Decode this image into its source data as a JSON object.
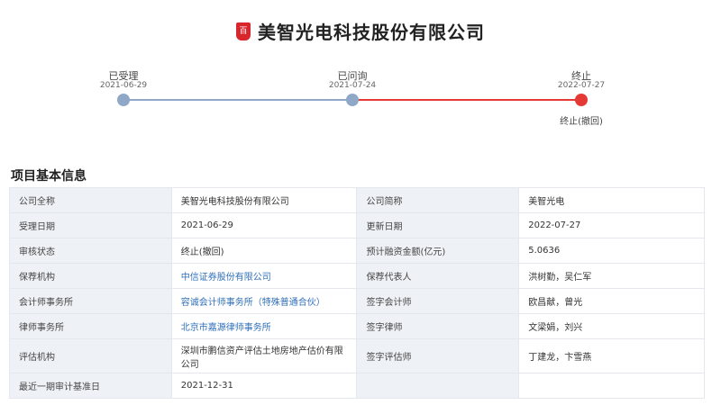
{
  "header": {
    "logo_text": "百",
    "company_name": "美智光电科技股份有限公司"
  },
  "timeline": {
    "steps": [
      {
        "label": "已受理",
        "date": "2021-06-29",
        "status": "done"
      },
      {
        "label": "已问询",
        "date": "2021-07-24",
        "status": "done"
      },
      {
        "label": "终止",
        "date": "2022-07-27",
        "status": "terminated",
        "sub": "终止(撤回)"
      }
    ],
    "colors": {
      "done": "#8fa8c8",
      "terminated": "#e53935"
    }
  },
  "section": {
    "title": "项目基本信息"
  },
  "info": {
    "rows": [
      {
        "l1": "公司全称",
        "v1": "美智光电科技股份有限公司",
        "l2": "公司简称",
        "v2": "美智光电"
      },
      {
        "l1": "受理日期",
        "v1": "2021-06-29",
        "l2": "更新日期",
        "v2": "2022-07-27"
      },
      {
        "l1": "审核状态",
        "v1": "终止(撤回)",
        "l2": "预计融资金额(亿元)",
        "v2": "5.0636"
      },
      {
        "l1": "保荐机构",
        "v1": "中信证券股份有限公司",
        "l2": "保荐代表人",
        "v2": "洪树勤，吴仁军"
      },
      {
        "l1": "会计师事务所",
        "v1": "容诚会计师事务所（特殊普通合伙）",
        "l2": "签字会计师",
        "v2": "欧昌献，曾光"
      },
      {
        "l1": "律师事务所",
        "v1": "北京市嘉源律师事务所",
        "l2": "签字律师",
        "v2": "文梁娟，刘兴"
      },
      {
        "l1": "评估机构",
        "v1": "深圳市鹏信资产评估土地房地产估价有限公司",
        "l2": "签字评估师",
        "v2": "丁建龙，卞雪燕"
      },
      {
        "l1": "最近一期审计基准日",
        "v1": "2021-12-31",
        "l2": "",
        "v2": ""
      }
    ]
  }
}
